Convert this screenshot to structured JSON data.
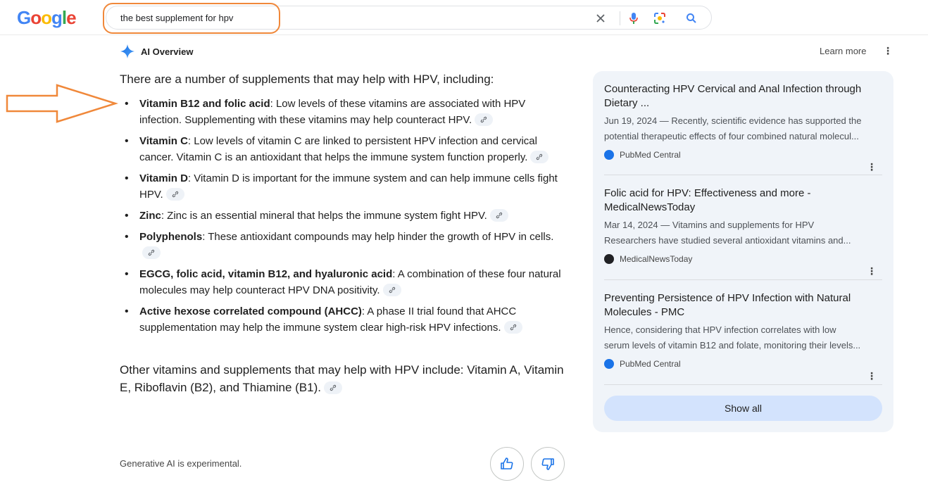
{
  "header": {
    "logo_text": "Google",
    "search_query": "the best supplement for hpv",
    "icons": [
      "close-icon",
      "microphone-icon",
      "lens-icon",
      "search-icon"
    ]
  },
  "ai_overview": {
    "title": "AI Overview",
    "learn_more": "Learn more",
    "intro": "There are a number of supplements that may help with HPV, including:",
    "items": [
      {
        "bold": "Vitamin B12 and folic acid",
        "text": ": Low levels of these vitamins are associated with HPV infection. Supplementing with these vitamins may help counteract HPV."
      },
      {
        "bold": "Vitamin C",
        "text": ": Low levels of vitamin C are linked to persistent HPV infection and cervical cancer. Vitamin C is an antioxidant that helps the immune system function properly."
      },
      {
        "bold": "Vitamin D",
        "text": ": Vitamin D is important for the immune system and can help immune cells fight HPV."
      },
      {
        "bold": "Zinc",
        "text": ": Zinc is an essential mineral that helps the immune system fight HPV."
      },
      {
        "bold": "Polyphenols",
        "text": ": These antioxidant compounds may help hinder the growth of HPV in cells."
      },
      {
        "bold": "EGCG, folic acid, vitamin B12, and hyaluronic acid",
        "text": ": A combination of these four natural molecules may help counteract HPV DNA positivity."
      },
      {
        "bold": "Active hexose correlated compound (AHCC)",
        "text": ": A phase II trial found that AHCC supplementation may help the immune system clear high-risk HPV infections."
      }
    ],
    "outro": "Other vitamins and supplements that may help with HPV include: Vitamin A, Vitamin E, Riboflavin (B2), and Thiamine (B1)."
  },
  "sources": [
    {
      "title": "Counteracting HPV Cervical and Anal Infection through Dietary ...",
      "snippet_1": "Jun 19, 2024 — Recently, scientific evidence has supported the",
      "snippet_2": "potential therapeutic effects of four combined natural molecul...",
      "site": "PubMed Central",
      "fav_color": "#1a73e8"
    },
    {
      "title": "Folic acid for HPV: Effectiveness and more - MedicalNewsToday",
      "snippet_1": "Mar 14, 2024 — Vitamins and supplements for HPV",
      "snippet_2": "Researchers have studied several antioxidant vitamins and...",
      "site": "MedicalNewsToday",
      "fav_color": "#202124"
    },
    {
      "title": "Preventing Persistence of HPV Infection with Natural Molecules - PMC",
      "snippet_1": "Hence, considering that HPV infection correlates with low",
      "snippet_2": "serum levels of vitamin B12 and folate, monitoring their levels...",
      "site": "PubMed Central",
      "fav_color": "#1a73e8"
    }
  ],
  "show_all": "Show all",
  "footer": {
    "disclaimer": "Generative AI is experimental."
  },
  "colors": {
    "annotation": "#f0883a",
    "panel_bg": "#f0f4f9",
    "show_all_bg": "#d3e3fd"
  }
}
